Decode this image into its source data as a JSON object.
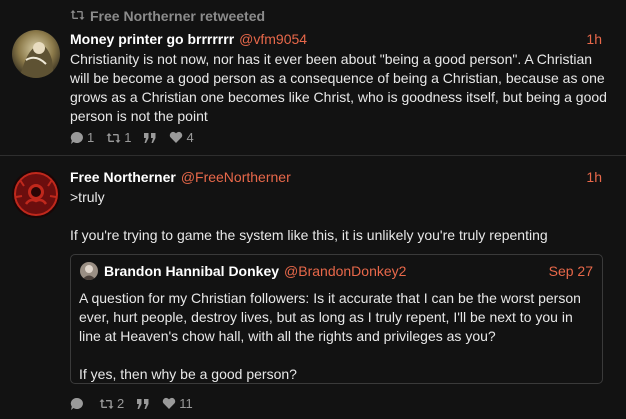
{
  "retweet_banner": {
    "text": "Free Northerner retweeted",
    "icon": "retweet-icon"
  },
  "tweets": [
    {
      "author_name": "Money printer go brrrrrrr",
      "author_handle": "@vfm9054",
      "time": "1h",
      "text": "Christianity is not now, nor has it ever been about \"being a good person\". A Christian will be become a good person as a consequence of being a Christian, because as one grows as a Christian one becomes like Christ, who is goodness itself, but being a good person is not the point",
      "replies": "1",
      "retweets": "1",
      "likes": "4"
    },
    {
      "author_name": "Free Northerner",
      "author_handle": "@FreeNortherner",
      "time": "1h",
      "text": ">truly\n\nIf you're trying to game the system like this, it is unlikely you're truly repenting",
      "quoted": {
        "author_name": "Brandon Hannibal Donkey",
        "author_handle": "@BrandonDonkey2",
        "time": "Sep 27",
        "text": "A question for my Christian followers: Is it accurate that I can be the worst person ever, hurt people, destroy lives, but as long as I truly repent, I'll be next to you in line at Heaven's chow hall, with all the rights and privileges as you?\n\nIf yes, then why be a good person?"
      },
      "replies": "",
      "retweets": "2",
      "likes": "11"
    }
  ],
  "colors": {
    "background": "#121212",
    "accent": "#e8684a",
    "muted": "#8b8b8b"
  }
}
